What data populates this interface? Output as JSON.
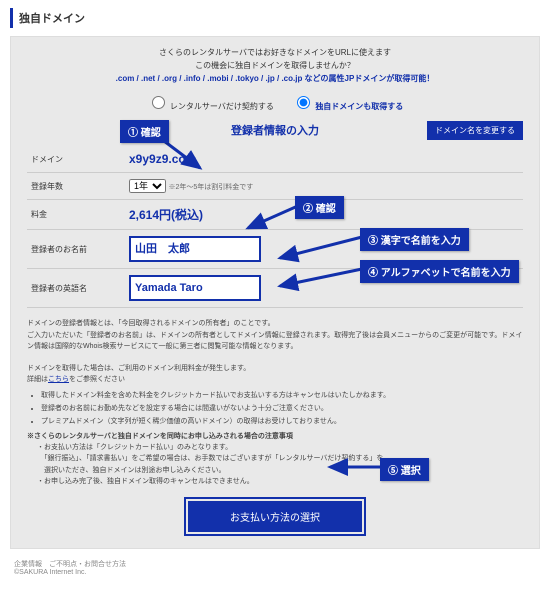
{
  "page_title": "独自ドメイン",
  "intro_line1": "さくらのレンタルサーバではお好きなドメインをURLに使えます",
  "intro_line2": "この機会に独自ドメインを取得しませんか？",
  "intro_line3": ".com / .net / .org / .info / .mobi / .tokyo / .jp / .co.jp などの属性JPドメインが取得可能！",
  "radio": {
    "a": "レンタルサーバだけ契約する",
    "b": "独自ドメインも取得する"
  },
  "section_title": "登録者情報の入力",
  "change_btn": "ドメイン名を変更する",
  "rows": {
    "domain_label": "ドメイン",
    "domain_value": "x9y9z9.com",
    "years_label": "登録年数",
    "years_value": "1年",
    "years_note": "※2年～5年は割引料金です",
    "price_label": "料金",
    "price_value": "2,614円(税込)",
    "name_label": "登録者のお名前",
    "name_value": "山田　太郎",
    "roman_label": "登録者の英語名",
    "roman_value": "Yamada Taro"
  },
  "notes": {
    "p1": "ドメインの登録者情報とは、「今回取得されるドメインの所有者」のことです。",
    "p2": "ご入力いただいた「登録者のお名前」は、ドメインの所有者としてドメイン情報に登録されます。取得完了後は会員メニューからのご変更が可能です。ドメイン情報は国際的なWhois検索サービスにて一般に第三者に閲覧可能な情報となります。",
    "p3": "ドメインを取得した場合は、ご利用のドメイン利用料金が発生します。",
    "p4_pre": "詳細は",
    "p4_link": "こちら",
    "p4_post": "をご参照ください",
    "li1": "取得したドメイン料金を含めた料金をクレジットカード払いでお支払いする方はキャンセルはいたしかねます。",
    "li2": "登録者のお名前にお勤め先などを設定する場合には間違いがないよう十分ご注意ください。",
    "li3": "プレミアムドメイン（文字列が短く稀少価値の高いドメイン）の取得はお受けしておりません。",
    "h2": "※さくらのレンタルサーバと独自ドメインを同時にお申し込みされる場合の注意事項",
    "s1": "・お支払い方法は「クレジットカード払い」のみとなります。",
    "s2": "　「銀行振込」、「請求書払い」をご希望の場合は、お手数ではございますが「レンタルサーバだけ契約する」を",
    "s2b": "　選択いただき、独自ドメインは別途お申し込みください。",
    "s3": "・お申し込み完了後、独自ドメイン取得のキャンセルはできません。"
  },
  "submit_label": "お支払い方法の選択",
  "footer_left": "企業情報　ご不明点・お問合せ方法",
  "footer_copy": "©SAKURA Internet Inc.",
  "annotations": {
    "c1": "① 確認",
    "c2": "② 確認",
    "c3": "③ 漢字で名前を入力",
    "c4": "④ アルファベットで名前を入力",
    "c5": "⑤ 選択"
  }
}
